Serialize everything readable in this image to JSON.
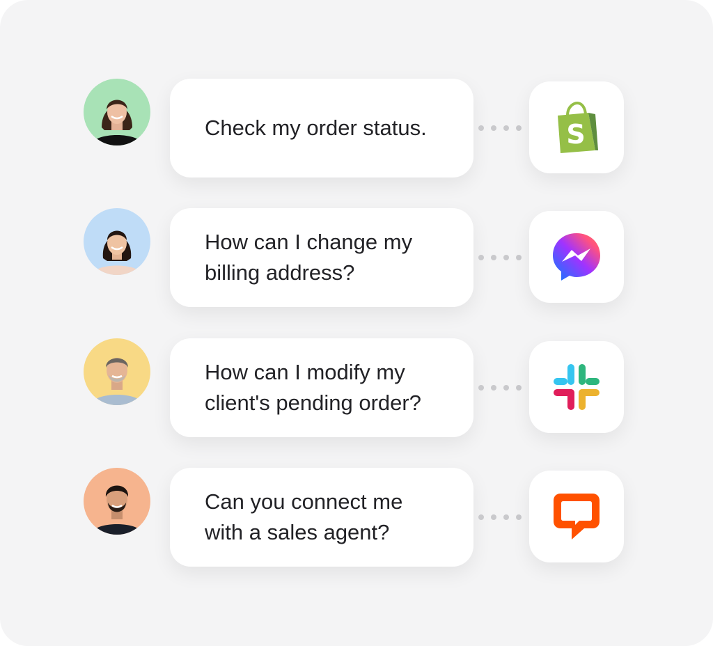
{
  "messages": [
    {
      "lines": [
        "Check my order status."
      ],
      "avatar_bg": "#a8e2b6",
      "app_icon": "shopify-icon"
    },
    {
      "lines": [
        "How can I change my",
        "billing address?"
      ],
      "avatar_bg": "#bfdcf7",
      "app_icon": "messenger-icon"
    },
    {
      "lines": [
        "How can I modify my",
        "client's pending order?"
      ],
      "avatar_bg": "#f8d985",
      "app_icon": "slack-icon"
    },
    {
      "lines": [
        "Can you connect me",
        "with a sales agent?"
      ],
      "avatar_bg": "#f6b48e",
      "app_icon": "livechat-icon"
    }
  ],
  "colors": {
    "background": "#f4f4f5",
    "bubble": "#ffffff",
    "text": "#222226",
    "connector_dot": "#c9c9cc",
    "shopify_green": "#95bf47",
    "livechat_orange": "#ff5100"
  }
}
